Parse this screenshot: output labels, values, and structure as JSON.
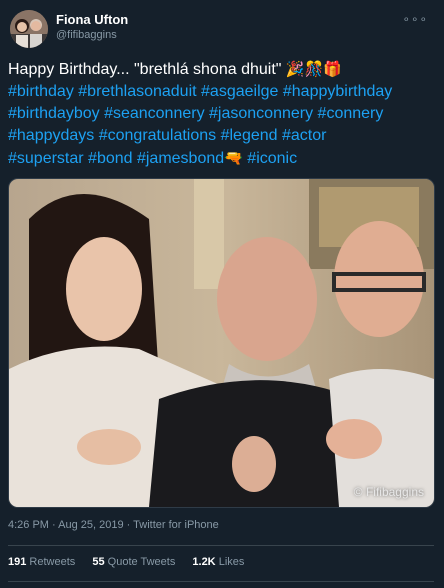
{
  "author": {
    "display_name": "Fiona Ufton",
    "handle": "@fifibaggins"
  },
  "more_icon": "ellipsis-icon",
  "tweet_lines": [
    {
      "plain": "Happy Birthday... \"brethlá shona dhuit\" ",
      "emoji": "🎉🎊🎁"
    },
    {
      "tags": "#birthday #brethlasonaduit #asgaeilge #happybirthday"
    },
    {
      "tags": "#birthdayboy #seanconnery #jasonconnery #connery"
    },
    {
      "tags": "#happydays #congratulations #legend #actor"
    },
    {
      "tags_a": "#superstar #bond #jamesbond",
      "emoji": "🔫",
      "tags_b": " #iconic"
    }
  ],
  "photo": {
    "watermark": "© Fifibaggins"
  },
  "meta": {
    "time": "4:26 PM",
    "date": "Aug 25, 2019",
    "source": "Twitter for iPhone",
    "separator": " · "
  },
  "stats": {
    "retweets_count": "191",
    "retweets_label": " Retweets",
    "quotes_count": "55",
    "quotes_label": " Quote Tweets",
    "likes_count": "1.2K",
    "likes_label": " Likes"
  },
  "colors": {
    "background": "#15202b",
    "hashtag": "#1da1f2",
    "secondary": "#8899a6"
  }
}
